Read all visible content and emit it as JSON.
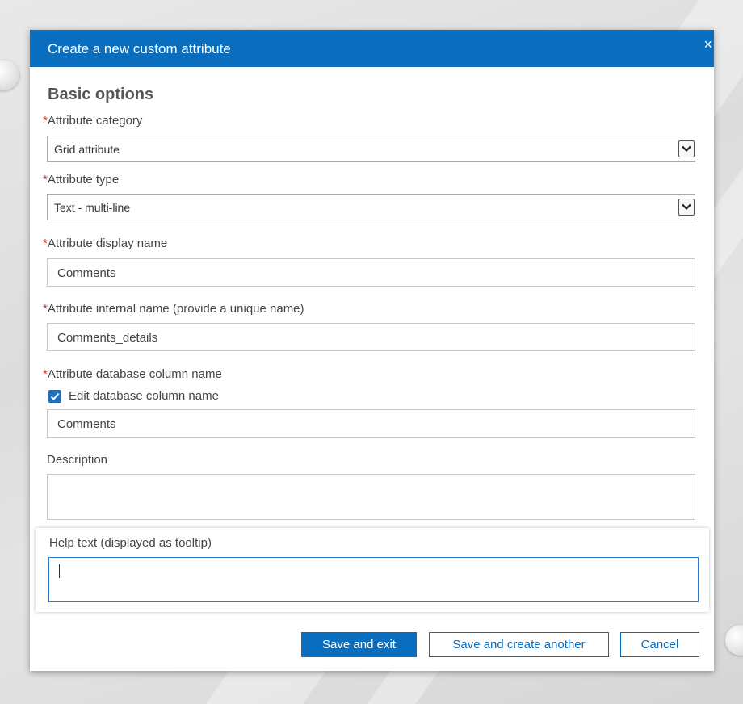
{
  "dialog": {
    "title": "Create a new custom attribute",
    "close_label": "×"
  },
  "section": {
    "title": "Basic options"
  },
  "required_mark": "*",
  "fields": {
    "attribute_category": {
      "label": "Attribute category",
      "value": "Grid attribute"
    },
    "attribute_type": {
      "label": "Attribute type",
      "value": "Text - multi-line"
    },
    "display_name": {
      "label": "Attribute display name",
      "value": "Comments"
    },
    "internal_name": {
      "label": "Attribute internal name (provide a unique name)",
      "value": "Comments_details"
    },
    "db_column_name": {
      "label": "Attribute database column name",
      "checkbox_label": "Edit database column name",
      "checked": true,
      "value": "Comments"
    },
    "description": {
      "label": "Description",
      "value": ""
    },
    "help_text": {
      "label": "Help text (displayed as tooltip)",
      "value": ""
    }
  },
  "buttons": {
    "save_exit": "Save and exit",
    "save_another": "Save and create another",
    "cancel": "Cancel"
  },
  "colors": {
    "accent": "#0a6dbd",
    "required": "#d9262b"
  },
  "icons": {
    "close": "close-icon",
    "dropdown": "chevron-down-icon",
    "check": "checkmark-icon"
  }
}
